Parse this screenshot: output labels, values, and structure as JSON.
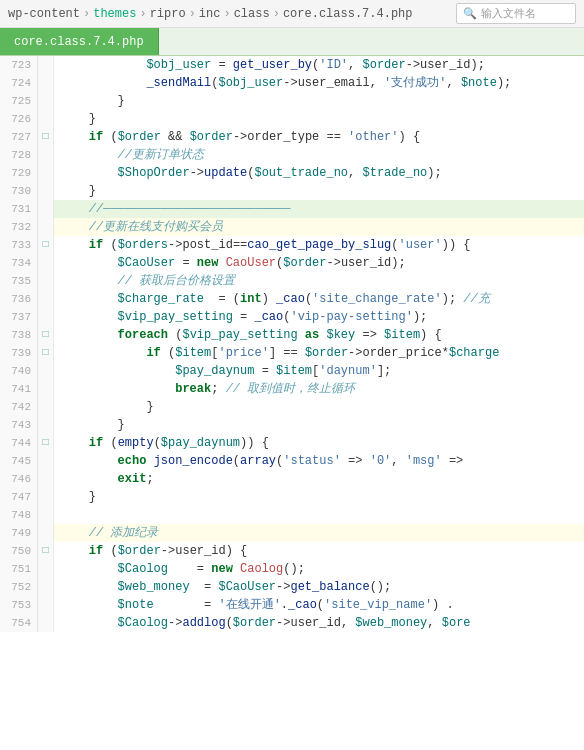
{
  "breadcrumb": {
    "parts": [
      "wp-content",
      "themes",
      "ripro",
      "inc",
      "class",
      "core.class.7.4.php"
    ],
    "separators": [
      " › ",
      " › ",
      " › ",
      " › ",
      " › "
    ],
    "search_placeholder": "输入文件名"
  },
  "tab": {
    "label": "core.class.7.4.php"
  },
  "lines": [
    {
      "num": "723",
      "fold": "",
      "code": "            <var>$obj_user</var> = <fn>get_user_by</fn>(<str>'ID'</str>, <var>$order</var>-><plain>user_id</plain>);"
    },
    {
      "num": "724",
      "fold": "",
      "code": "            <fn>_sendMail</fn>(<var>$obj_user</var>-><plain>user_email</plain>, <str>'支付成功'</str>, <var>$note</var>);"
    },
    {
      "num": "725",
      "fold": "",
      "code": "        }"
    },
    {
      "num": "726",
      "fold": "",
      "code": "    }"
    },
    {
      "num": "727",
      "fold": "□",
      "code": "    <kw>if</kw> (<var>$order</var> && <var>$order</var>-><plain>order_type</plain> == <str>'other'</str>) {"
    },
    {
      "num": "728",
      "fold": "",
      "code": "        <cmt>//更新订单状态</cmt>"
    },
    {
      "num": "729",
      "fold": "",
      "code": "        <var>$ShopOrder</var>-><fn>update</fn>(<var>$out_trade_no</var>, <var>$trade_no</var>);"
    },
    {
      "num": "730",
      "fold": "",
      "code": "    }"
    },
    {
      "num": "731",
      "fold": "",
      "code": "    <cmt>//——————————————————————————</cmt>",
      "highlight": true
    },
    {
      "num": "732",
      "fold": "",
      "code": "    <cmt>//更新在线支付购买会员</cmt>"
    },
    {
      "num": "733",
      "fold": "□",
      "code": "    <kw>if</kw> (<var>$orders</var>-><plain>post_id</plain>==<fn>cao_get_page_by_slug</fn>(<str>'user'</str>)) {"
    },
    {
      "num": "734",
      "fold": "",
      "code": "        <var>$CaoUser</var> = <kw>new</kw> <cn>CaoUser</cn>(<var>$order</var>-><plain>user_id</plain>);"
    },
    {
      "num": "735",
      "fold": "",
      "code": "        <cmt>// 获取后台价格设置</cmt>"
    },
    {
      "num": "736",
      "fold": "",
      "code": "        <var>$charge_rate</var>  = (<kw>int</kw>) <fn>_cao</fn>(<str>'site_change_rate'</str>); <cmt>//充</cmt>"
    },
    {
      "num": "737",
      "fold": "",
      "code": "        <var>$vip_pay_setting</var> = <fn>_cao</fn>(<str>'vip-pay-setting'</str>);"
    },
    {
      "num": "738",
      "fold": "□",
      "code": "        <kw>foreach</kw> (<var>$vip_pay_setting</var> <kw>as</kw> <var>$key</var> => <var>$item</var>) {"
    },
    {
      "num": "739",
      "fold": "□",
      "code": "            <kw>if</kw> (<var>$item</var>[<str>'price'</str>] == <var>$order</var>-><plain>order_price</plain>*<var>$charge</var>"
    },
    {
      "num": "740",
      "fold": "",
      "code": "                <var>$pay_daynum</var> = <var>$item</var>[<str>'daynum'</str>];"
    },
    {
      "num": "741",
      "fold": "",
      "code": "                <kw>break</kw>; <cmt>// 取到值时，终止循环</cmt>"
    },
    {
      "num": "742",
      "fold": "",
      "code": "            }"
    },
    {
      "num": "743",
      "fold": "",
      "code": "        }"
    },
    {
      "num": "744",
      "fold": "□",
      "code": "    <kw>if</kw> (<fn>empty</fn>(<var>$pay_daynum</var>)) {"
    },
    {
      "num": "745",
      "fold": "",
      "code": "        <kw>echo</kw> <fn>json_encode</fn>(<fn>array</fn>(<str>'status'</str> => <str>'0'</str>, <str>'msg'</str> =>"
    },
    {
      "num": "746",
      "fold": "",
      "code": "        <kw>exit</kw>;"
    },
    {
      "num": "747",
      "fold": "",
      "code": "    }"
    },
    {
      "num": "748",
      "fold": "",
      "code": ""
    },
    {
      "num": "749",
      "fold": "",
      "code": "    <cmt>// 添加纪录</cmt>"
    },
    {
      "num": "750",
      "fold": "□",
      "code": "    <kw>if</kw> (<var>$order</var>-><plain>user_id</plain>) {"
    },
    {
      "num": "751",
      "fold": "",
      "code": "        <var>$Caolog</var>    = <kw>new</kw> <cn>Caolog</cn>();"
    },
    {
      "num": "752",
      "fold": "",
      "code": "        <var>$web_money</var>  = <var>$CaoUser</var>-><fn>get_balance</fn>();"
    },
    {
      "num": "753",
      "fold": "",
      "code": "        <var>$note</var>       = <str>'在线开通'</str>.<fn>_cao</fn>(<str>'site_vip_name'</str>) ."
    },
    {
      "num": "754",
      "fold": "",
      "code": "        <var>$Caolog</var>-><fn>addlog</fn>(<var>$order</var>-><plain>user_id</plain>, <var>$web_money</var>, <var>$ore</var>"
    }
  ],
  "colors": {
    "tab_bg": "#5db85c",
    "tab_text": "#ffffff",
    "breadcrumb_bg": "#f5f5f5",
    "line_num_bg": "#f9f9f9",
    "highlight_line": "#e8f5e0",
    "comment_yellow": "#fffde7"
  }
}
